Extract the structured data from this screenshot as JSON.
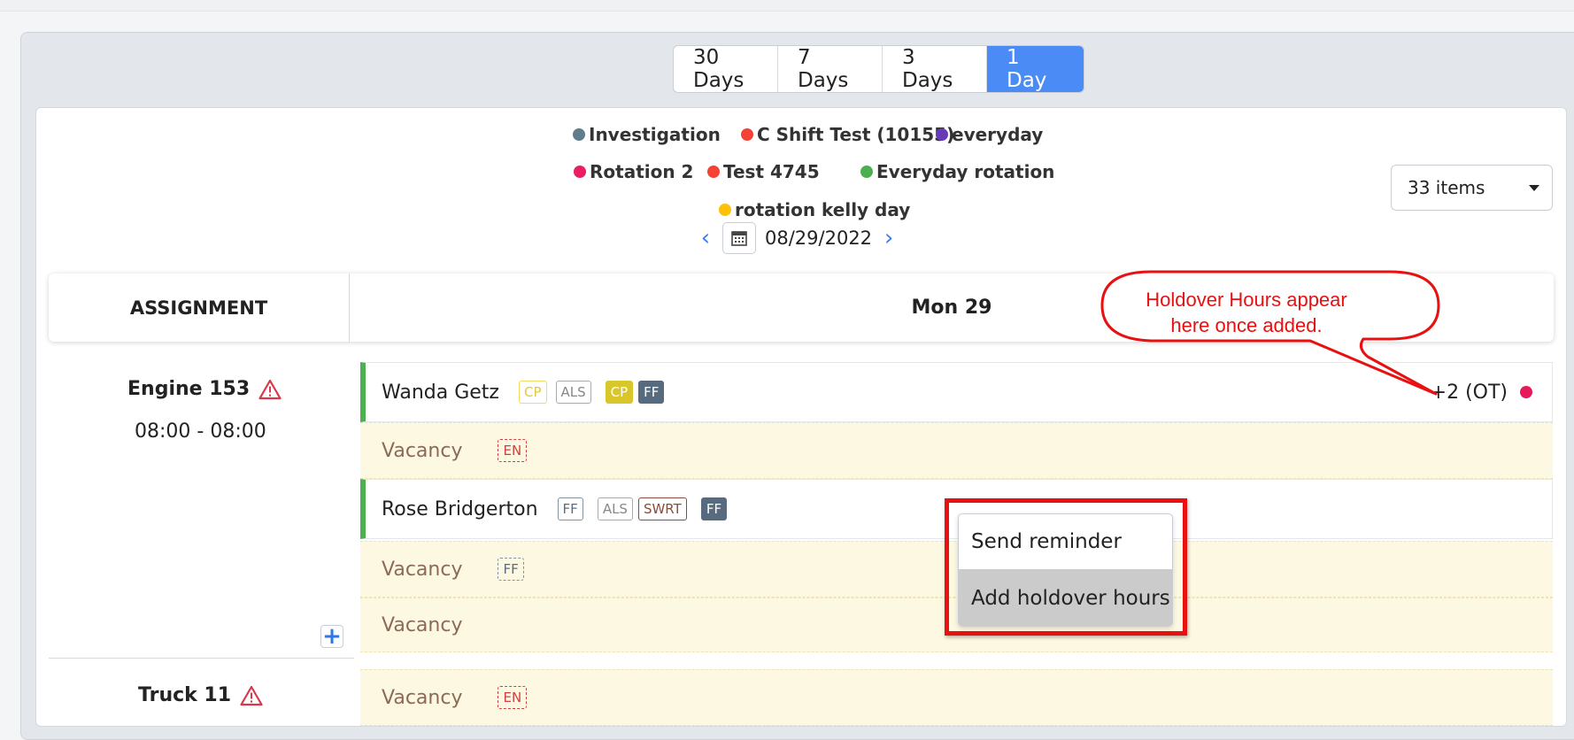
{
  "view_tabs": [
    "30 Days",
    "7 Days",
    "3 Days",
    "1 Day"
  ],
  "active_tab": "1 Day",
  "legend": [
    {
      "label": "Investigation",
      "color": "#607d8b"
    },
    {
      "label": "C Shift Test (10155)",
      "color": "#f44336"
    },
    {
      "label": "everyday",
      "color": "#673ab7"
    },
    {
      "label": "Rotation 2",
      "color": "#e91e63"
    },
    {
      "label": "Test 4745",
      "color": "#f44336"
    },
    {
      "label": "Everyday rotation",
      "color": "#4caf50"
    },
    {
      "label": "rotation kelly day",
      "color": "#ffc107"
    }
  ],
  "items_select": {
    "value": "33 items"
  },
  "date_nav": {
    "date": "08/29/2022",
    "prev_icon": "chevron-left-icon",
    "next_icon": "chevron-right-icon",
    "calendar_icon": "calendar-icon"
  },
  "table_header": {
    "assignment": "ASSIGNMENT",
    "day": "Mon 29"
  },
  "assignments": [
    {
      "name": "Engine 153",
      "time": "08:00 - 08:00",
      "warning_icon": "warning-triangle-icon"
    },
    {
      "name": "Truck 11",
      "warning_icon": "warning-triangle-icon"
    }
  ],
  "rows": [
    {
      "type": "staff",
      "name": "Wanda Getz",
      "badges": [
        "CP",
        "ALS",
        "CP",
        "FF"
      ],
      "overtime": "+2 (OT)",
      "dot_color": "#e6195a"
    },
    {
      "type": "vacancy",
      "label": "Vacancy",
      "badge": "EN"
    },
    {
      "type": "staff",
      "name": "Rose Bridgerton",
      "badges": [
        "FF",
        "ALS",
        "SWRT",
        "FF"
      ]
    },
    {
      "type": "vacancy",
      "label": "Vacancy",
      "badge": "FF"
    },
    {
      "type": "vacancy",
      "label": "Vacancy"
    },
    {
      "type": "vacancy",
      "label": "Vacancy",
      "badge": "EN"
    }
  ],
  "context_menu": {
    "items": [
      "Send reminder",
      "Add holdover hours"
    ],
    "highlighted": "Add holdover hours"
  },
  "callout": {
    "text_line1": "Holdover Hours appear",
    "text_line2": "here once added.",
    "color": "#e81010"
  },
  "add_icon": "plus-icon"
}
